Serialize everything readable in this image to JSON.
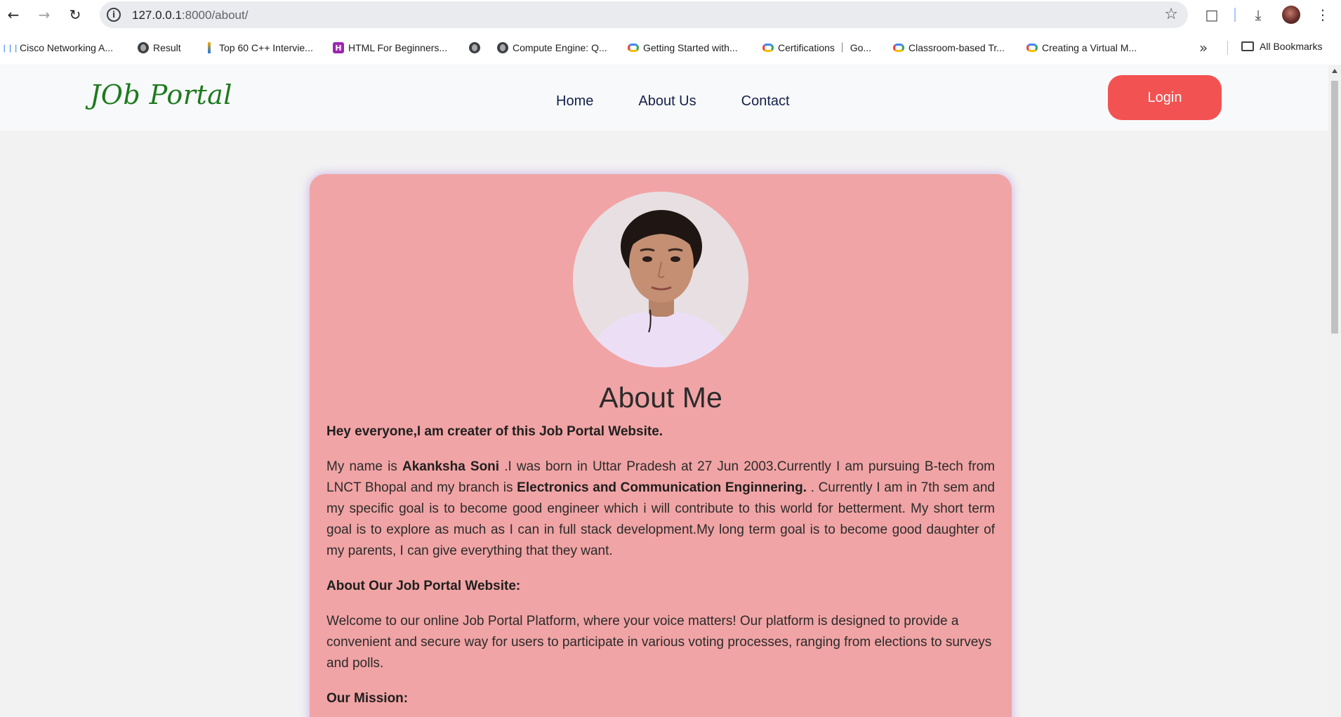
{
  "browser": {
    "url_host": "127.0.0.1",
    "url_path": ":8000/about/",
    "bookmarks": [
      {
        "label": "Cisco Networking A...",
        "icon": "cisco-icon"
      },
      {
        "label": "Result",
        "icon": "globe-icon"
      },
      {
        "label": "Top 60 C++ Intervie...",
        "icon": "bar-icon"
      },
      {
        "label": "HTML For Beginners...",
        "icon": "h-icon"
      },
      {
        "label": "",
        "icon": "globe-icon"
      },
      {
        "label": "Compute Engine: Q...",
        "icon": "globe-icon"
      },
      {
        "label": "Getting Started with...",
        "icon": "cloud-icon"
      },
      {
        "label": "Certifications ｜ Go...",
        "icon": "cloud-icon"
      },
      {
        "label": "Classroom-based Tr...",
        "icon": "cloud-icon"
      },
      {
        "label": "Creating a Virtual M...",
        "icon": "cloud-icon"
      }
    ],
    "all_bookmarks": "All Bookmarks"
  },
  "site": {
    "logo": "JOb Portal",
    "nav": {
      "home": "Home",
      "about": "About Us",
      "contact": "Contact"
    },
    "login": "Login"
  },
  "about": {
    "title": "About Me",
    "intro": "Hey everyone,I am creater of this Job Portal Website.",
    "p1_a": "My name is ",
    "p1_name": "Akanksha Soni",
    "p1_b": " .I was born in Uttar Pradesh at 27 Jun 2003.Currently I am pursuing B-tech from LNCT Bhopal and my branch is ",
    "p1_branch": "Electronics and Communication Enginnering.",
    "p1_c": " . Currently I am in 7th sem and my specific goal is to become good engineer which i will contribute to this world for betterment. My short term goal is to explore as much as I can in full stack development.My long term goal is to become good daughter of my parents, I can give everything that they want.",
    "website_heading": "About Our Job Portal Website:",
    "website_text": "Welcome to our online Job Portal Platform, where your voice matters! Our platform is designed to provide a convenient and secure way for users to participate in various voting processes, ranging from elections to surveys and polls.",
    "mission_heading": "Our Mission:"
  },
  "colors": {
    "card_bg": "#f1a4a5",
    "login_bg": "#f25252",
    "logo": "#1d7a1f",
    "nav_text": "#14204a"
  }
}
